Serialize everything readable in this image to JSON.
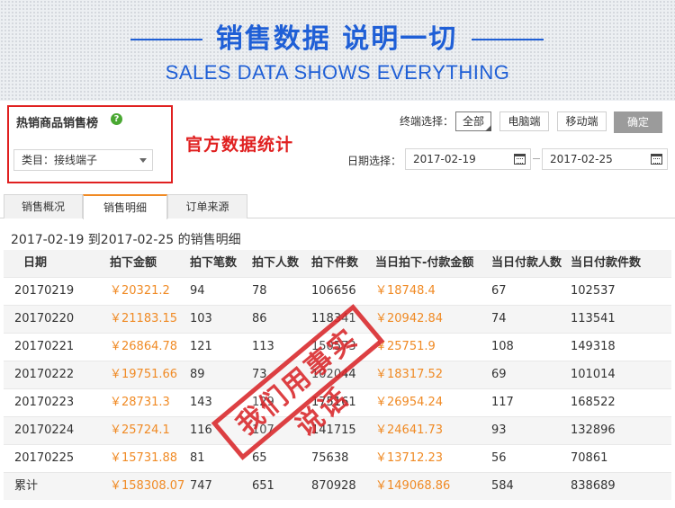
{
  "banner": {
    "title": "销售数据  说明一切",
    "subtitle": "SALES DATA SHOWS EVERYTHING"
  },
  "panel": {
    "title": "热销商品销售榜",
    "help_icon": "question-circle-icon",
    "category_select": "类目：接线端子",
    "note": "官方数据统计",
    "terminal_label": "终端选择：",
    "terminals": [
      "全部",
      "电脑端",
      "移动端"
    ],
    "selected_terminal": "全部",
    "confirm": "确定",
    "date_label": "日期选择：",
    "date_start": "2017-02-19",
    "date_end": "2017-02-25"
  },
  "tabs": [
    "销售概况",
    "销售明细",
    "订单来源"
  ],
  "active_tab": "销售明细",
  "section_title": "2017-02-19  到2017-02-25  的销售明细",
  "table": {
    "headers": [
      "日期",
      "拍下金额",
      "拍下笔数",
      "拍下人数",
      "拍下件数",
      "当日拍下-付款金额",
      "当日付款人数",
      "当日付款件数"
    ],
    "rows": [
      [
        "20170219",
        "￥20321.2",
        "94",
        "78",
        "106656",
        "￥18748.4",
        "67",
        "102537"
      ],
      [
        "20170220",
        "￥21183.15",
        "103",
        "86",
        "118341",
        "￥20942.84",
        "74",
        "113541"
      ],
      [
        "20170221",
        "￥26864.78",
        "121",
        "113",
        "150573",
        "￥25751.9",
        "108",
        "149318"
      ],
      [
        "20170222",
        "￥19751.66",
        "89",
        "73",
        "102044",
        "￥18317.52",
        "69",
        "101014"
      ],
      [
        "20170223",
        "￥28731.3",
        "143",
        "129",
        "175161",
        "￥26954.24",
        "117",
        "168522"
      ],
      [
        "20170224",
        "￥25724.1",
        "116",
        "107",
        "141715",
        "￥24641.73",
        "93",
        "132896"
      ],
      [
        "20170225",
        "￥15731.88",
        "81",
        "65",
        "75638",
        "￥13712.23",
        "56",
        "70861"
      ],
      [
        "累计",
        "￥158308.07",
        "747",
        "651",
        "870928",
        "￥149068.86",
        "584",
        "838689"
      ]
    ]
  },
  "stamp": "我们用事实说话",
  "colors": {
    "brand_blue": "#1f5fd6",
    "accent_orange": "#f08a24",
    "alert_red": "#e02020",
    "stamp_red": "#d9262a"
  }
}
